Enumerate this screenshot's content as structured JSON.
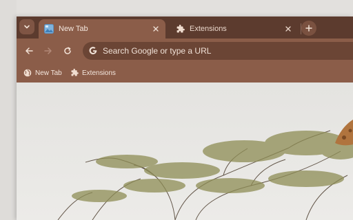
{
  "tabs": [
    {
      "label": "New Tab",
      "icon": "new-tab-favicon-icon",
      "active": true
    },
    {
      "label": "Extensions",
      "icon": "puzzle-icon",
      "active": false
    }
  ],
  "toolbar": {
    "omnibox_placeholder": "Search Google or type a URL"
  },
  "bookmarks": [
    {
      "label": "New Tab",
      "icon": "globe-icon"
    },
    {
      "label": "Extensions",
      "icon": "puzzle-icon"
    }
  ],
  "theme": {
    "tabstrip": "#5c3b2e",
    "toolbar": "#8b5d49",
    "omnibox": "#6b4535",
    "content_bg": "#e7e6e3"
  },
  "background_image": "acacia-tree-with-giraffe-photo"
}
